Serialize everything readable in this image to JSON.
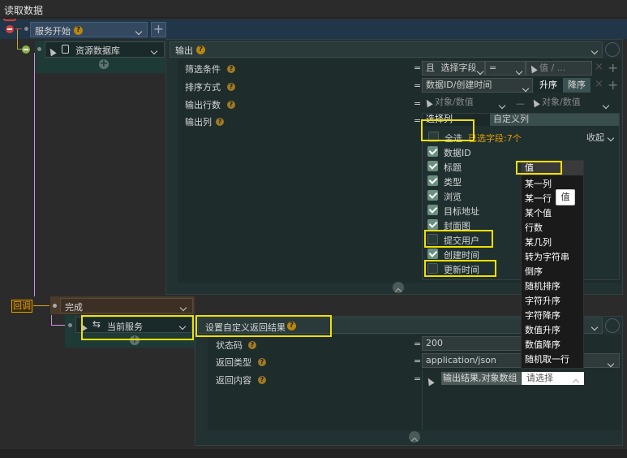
{
  "title": "读取数据",
  "service_start": {
    "label": "服务开始"
  },
  "resource_db": {
    "label": "资源数据库"
  },
  "output": {
    "header": "输出",
    "rows": {
      "filter": {
        "label": "筛选条件",
        "conj": "且",
        "field": "选择字段",
        "op": "=",
        "value": "值 / ..."
      },
      "sort": {
        "label": "排序方式",
        "field": "数据ID/创建时间",
        "asc": "升序",
        "desc": "降序"
      },
      "rows_count": {
        "label": "输出行数",
        "from": "对象/数值",
        "to": "对象/数值"
      },
      "columns": {
        "label": "输出列"
      }
    },
    "eq": "=",
    "dash": "—",
    "tabs": {
      "select": "选择列",
      "custom": "自定义列"
    },
    "select_all": "全选",
    "selected_count": "已选字段:7个",
    "collapse": "收起",
    "fields": [
      {
        "label": "数据ID",
        "checked": true
      },
      {
        "label": "标题",
        "checked": true
      },
      {
        "label": "类型",
        "checked": true
      },
      {
        "label": "浏览",
        "checked": true
      },
      {
        "label": "目标地址",
        "checked": true
      },
      {
        "label": "封面图",
        "checked": true
      },
      {
        "label": "提交用户",
        "checked": false
      },
      {
        "label": "创建时间",
        "checked": true
      },
      {
        "label": "更新时间",
        "checked": false
      }
    ]
  },
  "dropdown": {
    "items": [
      "值",
      "某一列",
      "某一行",
      "某个值",
      "行数",
      "某几列",
      "转为字符串",
      "倒序",
      "随机排序",
      "字符升序",
      "字符降序",
      "数值升序",
      "数值降序",
      "随机取一行"
    ],
    "tooltip": "值"
  },
  "callback": {
    "tag": "回调",
    "label": "完成"
  },
  "current_service": {
    "label": "当前服务"
  },
  "custom_return": {
    "header": "设置自定义返回结果",
    "status": {
      "label": "状态码",
      "value": "200"
    },
    "type": {
      "label": "返回类型",
      "value": "application/json"
    },
    "content": {
      "label": "返回内容",
      "value": "输出结果,对象数组",
      "select": "请选择"
    }
  },
  "colors": {
    "accent": "#f0e000",
    "panel": "#1e2c2c",
    "header": "#22364a",
    "check": "#6a8f7e",
    "link": "#d18fe8",
    "orange": "#e1a000",
    "red": "#d04040",
    "green": "#8ab04a"
  }
}
